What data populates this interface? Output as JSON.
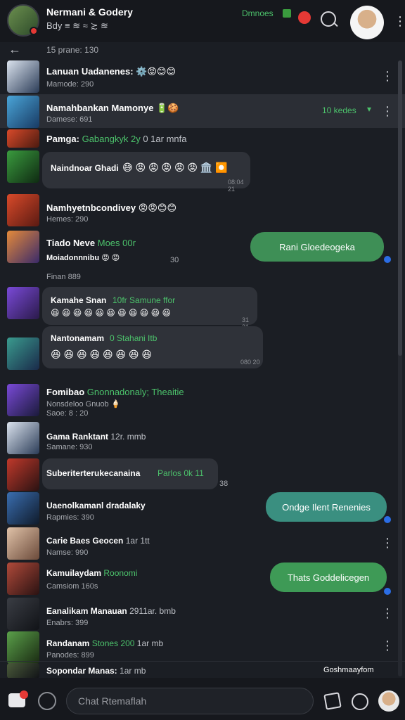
{
  "header": {
    "title": "Nermani & Godery",
    "subtitle": "Bdy ≡ ≋ ≈ ≿ ≋",
    "status": "Dmnoes",
    "icons": [
      "group-avatar-icon",
      "alert-icon",
      "search-icon",
      "profile-avatar",
      "more-icon"
    ]
  },
  "subbar": {
    "text": "15 prane: 130"
  },
  "rows": [
    {
      "name": "Lanuan Uadanenes:",
      "emoji": "⚙️😡😊😊",
      "sub": "Mamode: 290"
    },
    {
      "name": "Namahbankan Mamonye",
      "emoji": "🔋🍪",
      "sub": "Damese: 691",
      "side": "10 kedes",
      "highlight": true
    },
    {
      "name": "Pamga:",
      "green": "Gabangkyk 2y",
      "rest": "0 1ar mnfa",
      "sub": ""
    },
    {
      "bubble": "Naindnoar Ghadi",
      "emoji": "😅 😡 😡 😡 😡 😡 🏛️ ⏺️",
      "time": "08:04 21"
    },
    {
      "name": "Namhyetnbcondivey",
      "emoji": "😡😡😊😊",
      "sub": "Hemes: 290"
    },
    {
      "name": "Tiado Neve",
      "green": "Moes 00r",
      "sub": "Moiadonnnibu 😡 😡",
      "time": "30",
      "greenBubble": "Rani Gloedeogeka"
    },
    {
      "name": "Finan 889",
      "small": true
    },
    {
      "bubble": "Kamahe Snan",
      "green": "10fr Samune ffor",
      "emoji": "😆 😆 😆 😆 😆 😆 😆 😆 😆 😆 😆",
      "time": "31 21"
    },
    {
      "bubble": "Nantonamam",
      "green": "0 Stahani Itb",
      "emoji": "😆 😆 😆 😆 😆 😆 😆 😆",
      "time": "080 20"
    },
    {
      "name": "Fomibao",
      "green": "Gnonnadonaly; Theaitie",
      "sub": "Nonsdeloo Gnuob 🍦",
      "sub2": "Saoe: 8 : 20"
    },
    {
      "name": "Gama Ranktant",
      "rest": "12r. mmb",
      "sub": "Samane: 930"
    },
    {
      "bubble": "Suberiterterukecanaina",
      "green": "Parlos 0k 11",
      "time": "38"
    },
    {
      "name": "Uaenolkamanl dradalaky",
      "sub": "Rapmies: 390",
      "greenBubble": "Ondge Ilent Renenies"
    },
    {
      "name": "Carie Baes Geocen",
      "rest": "1ar 1tt",
      "sub": "Namse: 990"
    },
    {
      "name": "Kamuilaydam",
      "green": "Roonomi",
      "sub": "Camsiom 160s",
      "greenBubble": "Thats Goddelicegen"
    },
    {
      "name": "Eanalikam Manauan",
      "rest": "2911ar. bmb",
      "sub": "Enabrs: 399"
    },
    {
      "name": "Randanam",
      "green": "Stones 200",
      "rest": "1ar mb",
      "sub": "Panodes: 899"
    },
    {
      "name": "Sopondar Manas:",
      "rest": "1ar mb",
      "side": "Goshmaayfom"
    }
  ],
  "composer": {
    "placeholder": "Chat Rtemaflah"
  },
  "colors": {
    "bg": "#1b1e24",
    "bar": "#16181d",
    "accent_green": "#4cc26b",
    "bubble_green": "#3e8f56",
    "bubble_dark": "#2f3239"
  }
}
